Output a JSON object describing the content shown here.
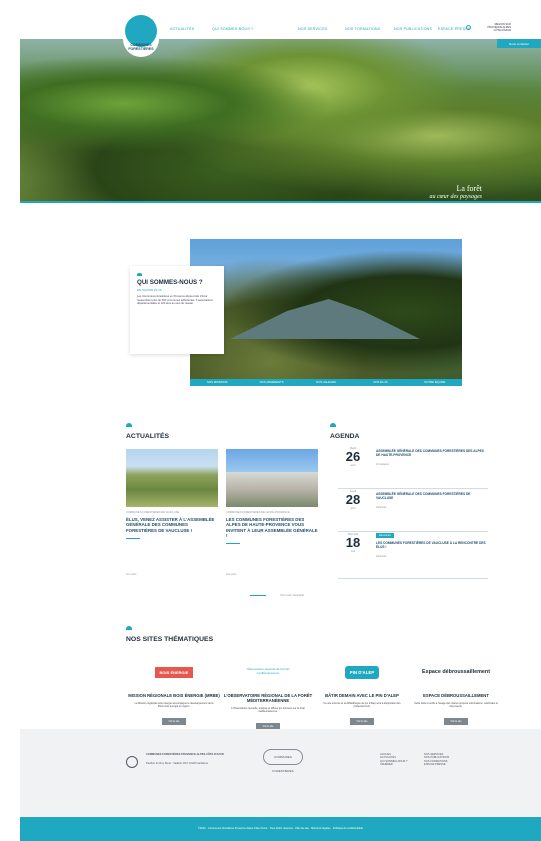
{
  "header": {
    "logo_text": "COMMUNES FORESTIÈRES",
    "nav": [
      "Actualités",
      "Qui sommes-nous ?",
      "Nos services",
      "Nos formations",
      "Nos publications",
      "Espace presse"
    ],
    "region_text": "RÉGION SUD PROVENCE ALPES CÔTE D'AZUR",
    "cta": "Nous contacter"
  },
  "hero": {
    "caption_line1": "La forêt",
    "caption_line2": "au cœur des paysages"
  },
  "about": {
    "title": "QUI SOMMES-NOUS ?",
    "subtitle": "EN SAVOIR PLUS",
    "text": "Les Communes forestières en Provence-Alpes-Côte d'Azur rassemblent plus de 500 communes adhérentes, 6 associations départementales et 100 élus au sein du réseau.",
    "tabs": [
      "Nos missions",
      "Nos adhérents",
      "Nos valeurs",
      "Nos élus",
      "Notre équipe"
    ]
  },
  "news": {
    "title": "ACTUALITÉS",
    "cards": [
      {
        "category": "Communes forestières de Vaucluse",
        "title": "Élus, venez assister à l'assemblée générale des Communes Forestières de Vaucluse !",
        "more": "Lire plus"
      },
      {
        "category": "Communes forestières de Haute-Provence",
        "title": "Les Communes Forestières des Alpes de Haute-Provence vous invitent à leur assemblée générale !",
        "more": "Lire plus"
      }
    ],
    "all_link": "Voir toute l'actualité"
  },
  "agenda": {
    "title": "AGENDA",
    "items": [
      {
        "weekday": "Mardi",
        "day": "26",
        "month": "avril",
        "title": "Assemblée générale des Communes Forestières des Alpes de Haute-Provence",
        "place": "Forcalquier"
      },
      {
        "weekday": "Jeudi",
        "day": "28",
        "month": "avril",
        "title": "Assemblée générale des Communes Forestières de Vaucluse",
        "place": "Vaucluse"
      },
      {
        "weekday": "Mercredi",
        "day": "18",
        "month": "mai",
        "badge": "Rencontre",
        "title": "Les Communes Forestières de Vaucluse à la rencontre des élus !",
        "place": "Vaucluse"
      }
    ]
  },
  "sites": {
    "title": "NOS SITES THÉMATIQUES",
    "items": [
      {
        "logo": "BOIS ÉNERGIE",
        "title": "MISSION RÉGIONALE BOIS ÉNERGIE (MRBE)",
        "text": "La Mission régionale bois énergie accompagne le développement de la filière bois énergie en région.",
        "button": "Voir le site"
      },
      {
        "logo": "Observatoire régional de la forêt méditerranéenne",
        "title": "L'OBSERVATOIRE RÉGIONAL DE LA FORÊT MÉDITERRANÉENNE",
        "text": "L'Observatoire recueille, analyse et diffuse les données sur la forêt méditerranéenne.",
        "button": "Voir le site"
      },
      {
        "logo": "PIN D'ALEP",
        "title": "BÂTIR DEMAIN AVEC LE PIN D'ALEP",
        "text": "Ce site internet et sa bibliothèque de pin d'Alep sont à disposition des professionnels.",
        "button": "Voir le site"
      },
      {
        "logo": "Espace débroussaillement",
        "title": "ESPACE DÉBROUSSAILLEMENT",
        "text": "Cette boîte à outils à l'usage des maires propose informations, méthodes et documents.",
        "button": "Voir le site"
      }
    ]
  },
  "footer": {
    "org": "COMMUNES FORESTIÈRES PROVENCE-ALPES-CÔTE D'AZUR",
    "address": "Pavillon du Roy René · Valabre CD7 13120 Gardanne",
    "links_a": [
      "Accueil",
      "Actualités",
      "Qui sommes-nous ?",
      "Adhérer"
    ],
    "links_b": [
      "Nos services",
      "Nos publications",
      "Nos formations",
      "Espace presse"
    ],
    "copyright": "©2022 · Communes forestières Provence-Alpes-Côte d'Azur · Tous droits réservés · Plan du site · Mentions légales · Politique de confidentialité"
  }
}
